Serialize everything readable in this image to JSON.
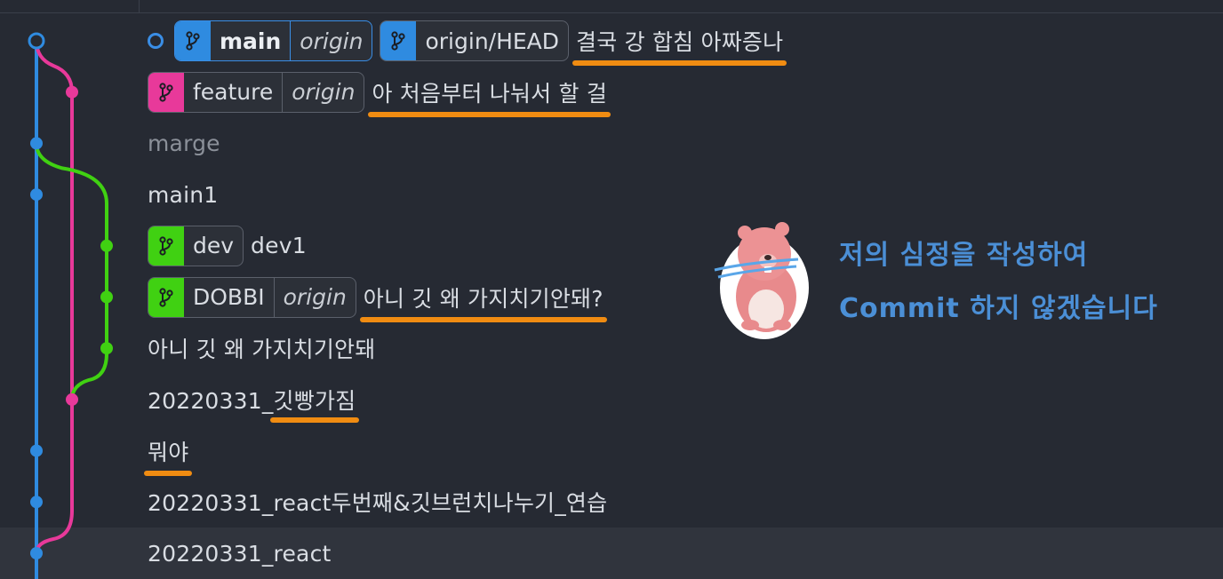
{
  "colors": {
    "main": "#2f8be0",
    "feature": "#e8399a",
    "dev": "#40d112",
    "underline": "#f08c12",
    "note": "#4b8fd6"
  },
  "commits": [
    {
      "refs": [
        {
          "name": "main",
          "remote": "origin",
          "color": "#2f8be0",
          "active": true
        },
        {
          "name": "origin/HEAD",
          "color": "#2f8be0"
        }
      ],
      "message": "결국 강 합침 아짜증나",
      "head": true
    },
    {
      "refs": [
        {
          "name": "feature",
          "remote": "origin",
          "color": "#e8399a"
        }
      ],
      "message": "아 처음부터 나눠서 할 걸"
    },
    {
      "message": "marge",
      "dim": true
    },
    {
      "message": "main1"
    },
    {
      "refs": [
        {
          "name": "dev",
          "color": "#40d112"
        }
      ],
      "message": "dev1"
    },
    {
      "refs": [
        {
          "name": "DOBBI",
          "remote": "origin",
          "color": "#40d112"
        }
      ],
      "message": "아니 깃 왜 가지치기안돼?"
    },
    {
      "message": "아니 깃 왜 가지치기안돼"
    },
    {
      "message_prefix": "20220331_",
      "message": "깃빵가짐"
    },
    {
      "message": "뭐야"
    },
    {
      "message": "20220331_react두번째&깃브런치나누기_연습"
    },
    {
      "message": "20220331_react",
      "selected": true
    }
  ],
  "note": {
    "line1": "저의 심정을 작성하여",
    "line2": "Commit 하지 않겠습니다"
  }
}
